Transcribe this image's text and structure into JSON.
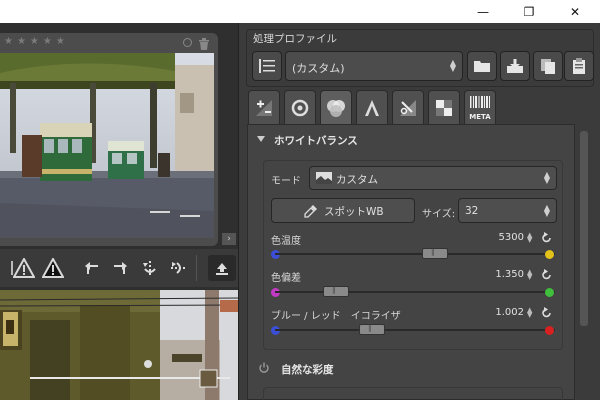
{
  "window": {
    "minimize_glyph": "—",
    "restore_glyph": "❐",
    "close_glyph": "✕"
  },
  "thumbnail": {
    "stars": "★★★★★"
  },
  "profile": {
    "title": "処理プロファイル",
    "selected": "(カスタム)"
  },
  "tabs": [
    "exposure-tab",
    "detail-tab",
    "color-tab",
    "transform-tab",
    "raw-tab",
    "advanced-tab",
    "meta-tab"
  ],
  "tab_meta_label": "META",
  "white_balance": {
    "title": "ホワイトバランス",
    "mode_label": "モード",
    "mode_value": "カスタム",
    "spot_label": "スポットWB",
    "size_label": "サイズ:",
    "size_value": "32",
    "temperature_label": "色温度",
    "temperature_value": "5300",
    "temperature_position": 0.58,
    "tint_label": "色偏差",
    "tint_value": "1.350",
    "tint_position": 0.19,
    "equalizer_label": "ブルー / レッド　イコライザ",
    "equalizer_value": "1.002",
    "equalizer_position": 0.33
  },
  "vibrance": {
    "title": "自然な彩度"
  },
  "colors": {
    "blue_dot": "#3a4fd6",
    "yellow_dot": "#e3c11b",
    "magenta_dot": "#c23ac4",
    "green_dot": "#3fbf3b",
    "red_dot": "#d82020"
  }
}
